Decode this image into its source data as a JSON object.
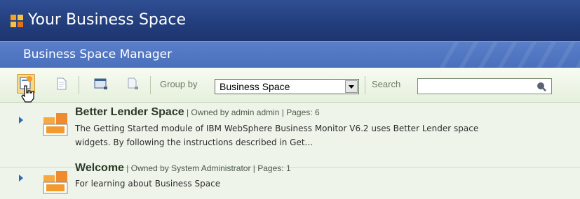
{
  "header": {
    "title": "Your Business Space"
  },
  "subheader": {
    "title": "Business Space Manager"
  },
  "toolbar": {
    "group_by_label": "Group by",
    "group_by_value": "Business Space",
    "search_label": "Search",
    "search_value": ""
  },
  "spaces": [
    {
      "name": "Better Lender Space",
      "meta": " | Owned by admin admin | Pages: 6",
      "desc1": "The Getting Started module of IBM WebSphere Business Monitor V6.2 uses Better Lender space",
      "desc2": "widgets. By following the instructions described in Get..."
    },
    {
      "name": "Welcome",
      "meta": " | Owned by System Administrator | Pages: 1",
      "desc1": "For learning about Business Space"
    }
  ],
  "colors": {
    "header": "#233e7c",
    "subheader": "#4a70bd",
    "toolbar": "#e6f0dd",
    "row": "#eef4ea",
    "accent_orange": "#f29a2e"
  }
}
